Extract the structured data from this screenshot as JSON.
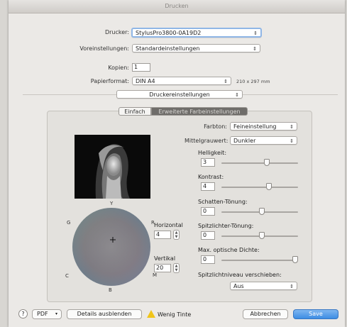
{
  "window": {
    "title": "Drucken"
  },
  "printer": {
    "label": "Drucker:",
    "value": "StylusPro3800-0A19D2"
  },
  "presets": {
    "label": "Voreinstellungen:",
    "value": "Standardeinstellungen"
  },
  "copies": {
    "label": "Kopien:",
    "value": "1"
  },
  "paper": {
    "label": "Papierformat:",
    "value": "DIN A4",
    "size_text": "210 x 297 mm"
  },
  "section": {
    "value": "Druckereinstellungen"
  },
  "tabs": [
    {
      "label": "Einfach"
    },
    {
      "label": "Erweiterte Farbeinstellungen"
    }
  ],
  "color_panel": {
    "color_tone": {
      "label": "Farbton:",
      "value": "Feineinstellung"
    },
    "mid_gray": {
      "label": "Mittelgrauwert:",
      "value": "Dunkler"
    },
    "brightness": {
      "label": "Helligkeit:",
      "value": "3"
    },
    "contrast": {
      "label": "Kontrast:",
      "value": "4"
    },
    "shadow_tone": {
      "label": "Schatten-Tönung:",
      "value": "0"
    },
    "highlight_tone": {
      "label": "Spitzlichter-Tönung:",
      "value": "0"
    },
    "max_density": {
      "label": "Max. optische Dichte:",
      "value": "0"
    },
    "highlight_shift": {
      "label": "Spitzlichtniveau verschieben:",
      "value": "Aus"
    },
    "horizontal": {
      "label": "Horizontal",
      "value": "4"
    },
    "vertical": {
      "label": "Vertikal",
      "value": "20"
    },
    "wheel_labels": {
      "top": "Y",
      "right": "R",
      "bottom_right": "M",
      "bottom": "B",
      "bottom_left": "C",
      "top_left": "G"
    }
  },
  "footer": {
    "help": "?",
    "pdf": "PDF",
    "details": "Details ausblenden",
    "warning": "Wenig Tinte",
    "cancel": "Abbrechen",
    "save": "Save"
  }
}
